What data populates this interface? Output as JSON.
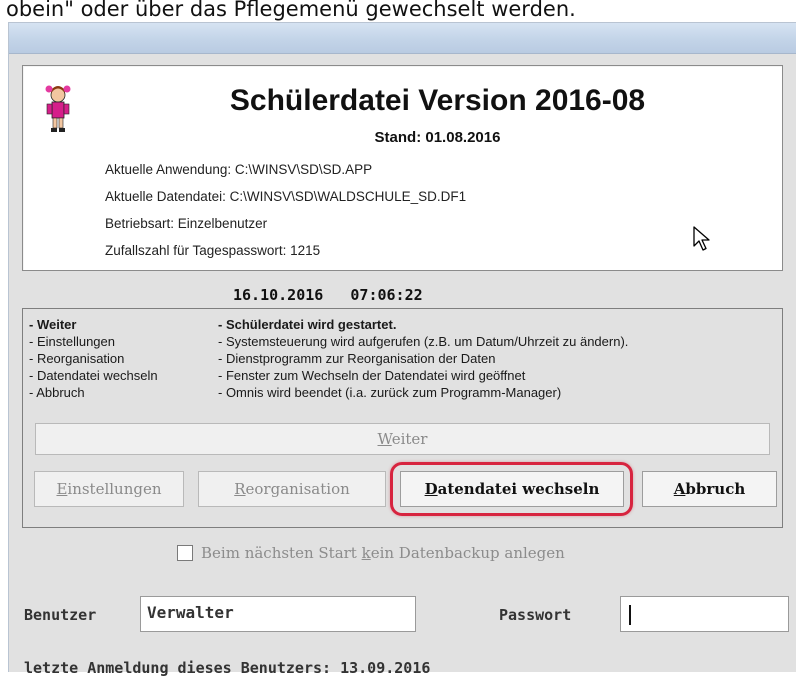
{
  "top_text": "obein\" oder über das Pflegemenü gewechselt werden.",
  "header": {
    "title": "Schülerdatei Version 2016-08",
    "stand": "Stand: 01.08.2016",
    "info_lines": [
      "Aktuelle Anwendung: C:\\WINSV\\SD\\SD.APP",
      "Aktuelle Datendatei: C:\\WINSV\\SD\\WALDSCHULE_SD.DF1",
      "Betriebsart:  Einzelbenutzer",
      "Zufallszahl für Tagespasswort: 1215"
    ]
  },
  "datetime": "16.10.2016   07:06:22",
  "options": [
    {
      "name": "- Weiter",
      "desc": "- Schülerdatei wird gestartet."
    },
    {
      "name": "- Einstellungen",
      "desc": "- Systemsteuerung wird aufgerufen (z.B. um Datum/Uhrzeit zu ändern)."
    },
    {
      "name": "- Reorganisation",
      "desc": "- Dienstprogramm zur Reorganisation der Daten"
    },
    {
      "name": "- Datendatei wechseln",
      "desc": "- Fenster zum Wechseln der Datendatei wird geöffnet"
    },
    {
      "name": "- Abbruch",
      "desc": "- Omnis wird beendet (i.a. zurück zum Programm-Manager)"
    }
  ],
  "buttons": {
    "weiter": {
      "access": "W",
      "rest": "eiter"
    },
    "einstellungen": {
      "access": "E",
      "rest": "instellungen"
    },
    "reorganisation": {
      "access": "R",
      "rest": "eorganisation"
    },
    "datendatei": {
      "access": "D",
      "rest": "atendatei wechseln"
    },
    "abbruch": {
      "access": "A",
      "rest": "bbruch"
    }
  },
  "checkbox": {
    "before": "Beim nächsten Start ",
    "access": "k",
    "after": "ein Datenbackup anlegen",
    "checked": false
  },
  "login": {
    "user_label": "Benutzer",
    "user_value": "Verwalter",
    "password_label": "Passwort",
    "password_value": "",
    "last_login": "letzte Anmeldung dieses Benutzers: 13.09.2016"
  },
  "colors": {
    "highlight": "#d7243f",
    "window_bg": "#e1e1e1",
    "titlebar": "#c3d4e8"
  },
  "icons": {
    "logo": "schoolgirl-figure-icon",
    "cursor": "mouse-pointer-icon"
  }
}
